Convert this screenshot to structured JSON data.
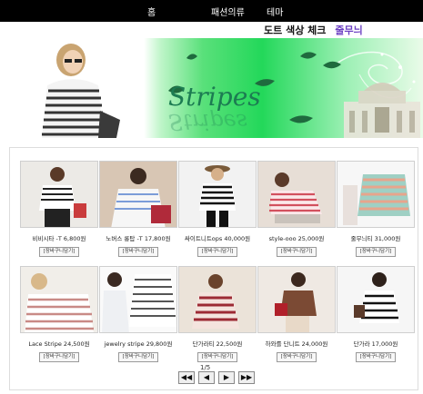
{
  "nav": [
    "홈",
    "패션의류",
    "테마"
  ],
  "categories": [
    "도트 색상 체크",
    "줄무늬"
  ],
  "banner": {
    "title": "Stripes",
    "reflection": "Stripes"
  },
  "cart_label": "[장바구니담기]",
  "products": [
    {
      "name": "비비시타 -T 6,800원"
    },
    {
      "name": "노버스 롱탑 -T 17,800원"
    },
    {
      "name": "싸이트니트ops 40,000원"
    },
    {
      "name": "style-ooo 25,000원"
    },
    {
      "name": "줄무늬티 31,000원"
    },
    {
      "name": "Lace Stripe 24,500원"
    },
    {
      "name": "jewelry stripe 29,800원"
    },
    {
      "name": "단가라티 22,500원"
    },
    {
      "name": "하와를 단니트 24,000원"
    },
    {
      "name": "단가라 17,000원"
    }
  ],
  "pager": {
    "label": "1/5",
    "first": "◀◀",
    "prev": "◀",
    "next": "▶",
    "last": "▶▶"
  }
}
